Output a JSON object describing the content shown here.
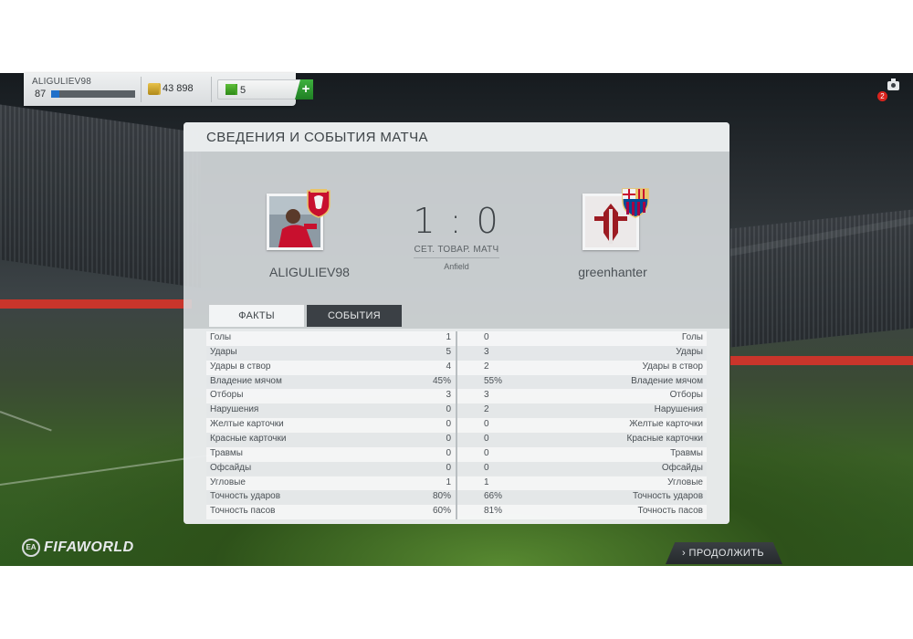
{
  "topbar": {
    "username": "ALIGULIEV98",
    "level": "87",
    "xp_progress": 0.1,
    "coins": "43 898",
    "points": "5",
    "add_label": "+"
  },
  "notifications": {
    "count": "2"
  },
  "panel": {
    "title": "СВЕДЕНИЯ И СОБЫТИЯ МАТЧА",
    "home_team": "ALIGULIEV98",
    "away_team": "greenhanter",
    "score": "1 : 0",
    "match_type": "СЕТ. ТОВАР. МАТЧ",
    "stadium": "Anfield",
    "home_club_badge_text": "LIVERPOOL",
    "away_club_badge_text": "FCB",
    "tabs": [
      {
        "label": "ФАКТЫ",
        "active": true
      },
      {
        "label": "СОБЫТИЯ",
        "active": false
      }
    ],
    "stats": [
      {
        "name": "Голы",
        "home": "1",
        "away": "0"
      },
      {
        "name": "Удары",
        "home": "5",
        "away": "3"
      },
      {
        "name": "Удары в створ",
        "home": "4",
        "away": "2"
      },
      {
        "name": "Владение мячом",
        "home": "45%",
        "away": "55%"
      },
      {
        "name": "Отборы",
        "home": "3",
        "away": "3"
      },
      {
        "name": "Нарушения",
        "home": "0",
        "away": "2"
      },
      {
        "name": "Желтые карточки",
        "home": "0",
        "away": "0"
      },
      {
        "name": "Красные карточки",
        "home": "0",
        "away": "0"
      },
      {
        "name": "Травмы",
        "home": "0",
        "away": "0"
      },
      {
        "name": "Офсайды",
        "home": "0",
        "away": "0"
      },
      {
        "name": "Угловые",
        "home": "1",
        "away": "1"
      },
      {
        "name": "Точность ударов",
        "home": "80%",
        "away": "66%"
      },
      {
        "name": "Точность пасов",
        "home": "60%",
        "away": "81%"
      }
    ]
  },
  "footer": {
    "logo_ea": "EA",
    "logo_text": "FIFAWORLD",
    "continue_label": "› ПРОДОЛЖИТЬ"
  },
  "colors": {
    "liverpool_red": "#c8102e",
    "barca_blue": "#004d98",
    "barca_red": "#a50044",
    "continue_bg": "#2b3034",
    "add_green": "#2e9a30"
  }
}
